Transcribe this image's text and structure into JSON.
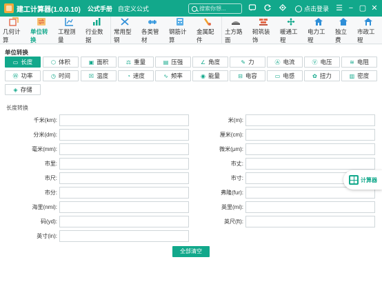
{
  "app": {
    "title": "建工计算器(1.0.0.10)"
  },
  "top_tabs": [
    {
      "label": "公式手册",
      "active": true
    },
    {
      "label": "自定义公式",
      "active": false
    }
  ],
  "search": {
    "placeholder": "搜索你想..."
  },
  "login": {
    "label": "点击登录"
  },
  "toolbar": [
    {
      "label": "几何计算",
      "icon": "geometry-icon",
      "color": "#e36a4a"
    },
    {
      "label": "单位转换",
      "icon": "unit-convert-icon",
      "color": "#f0a030",
      "active": true
    },
    {
      "label": "工程测量",
      "icon": "measure-icon",
      "color": "#2f8fd8"
    },
    {
      "label": "行业数据",
      "icon": "chart-icon",
      "color": "#12a88b"
    },
    {
      "label": "常用型钢",
      "icon": "steel-icon",
      "color": "#2f8fd8"
    },
    {
      "label": "各类管材",
      "icon": "pipe-icon",
      "color": "#2f8fd8"
    },
    {
      "label": "钢筋计算",
      "icon": "rebar-icon",
      "color": "#2f8fd8"
    },
    {
      "label": "金属配件",
      "icon": "metal-icon",
      "color": "#f0a030"
    },
    {
      "label": "土方路面",
      "icon": "earthwork-icon",
      "color": "#7a7a7a"
    },
    {
      "label": "砌筑装饰",
      "icon": "brick-icon",
      "color": "#e36a4a"
    },
    {
      "label": "暖通工程",
      "icon": "hvac-icon",
      "color": "#12a88b"
    },
    {
      "label": "电力工程",
      "icon": "power-icon",
      "color": "#2f8fd8"
    },
    {
      "label": "独立费",
      "icon": "house-icon",
      "color": "#2f8fd8"
    },
    {
      "label": "市政工程",
      "icon": "municipal-icon",
      "color": "#2f8fd8"
    }
  ],
  "section_title": "单位转换",
  "units": [
    {
      "label": "长度",
      "icon": "length-icon",
      "glyph": "▭",
      "active": true
    },
    {
      "label": "体积",
      "icon": "volume-icon",
      "glyph": "⬡"
    },
    {
      "label": "面积",
      "icon": "area-icon",
      "glyph": "▣"
    },
    {
      "label": "重量",
      "icon": "weight-icon",
      "glyph": "⚖"
    },
    {
      "label": "压强",
      "icon": "pressure-icon",
      "glyph": "▤"
    },
    {
      "label": "角度",
      "icon": "angle-icon",
      "glyph": "∠"
    },
    {
      "label": "力",
      "icon": "force-icon",
      "glyph": "✎"
    },
    {
      "label": "电流",
      "icon": "current-icon",
      "glyph": "Ⓐ"
    },
    {
      "label": "电压",
      "icon": "voltage-icon",
      "glyph": "Ⓥ"
    },
    {
      "label": "电阻",
      "icon": "resistance-icon",
      "glyph": "≋"
    },
    {
      "label": "功率",
      "icon": "power-unit-icon",
      "glyph": "Ⓦ"
    },
    {
      "label": "时间",
      "icon": "clock-icon",
      "glyph": "◷"
    },
    {
      "label": "温度",
      "icon": "temperature-icon",
      "glyph": "☒"
    },
    {
      "label": "速度",
      "icon": "speed-icon",
      "glyph": "◔"
    },
    {
      "label": "频率",
      "icon": "frequency-icon",
      "glyph": "∿"
    },
    {
      "label": "能量",
      "icon": "energy-icon",
      "glyph": "◉"
    },
    {
      "label": "电容",
      "icon": "capacitance-icon",
      "glyph": "⊟"
    },
    {
      "label": "电感",
      "icon": "inductance-icon",
      "glyph": "▭"
    },
    {
      "label": "扭力",
      "icon": "torque-icon",
      "glyph": "✿"
    },
    {
      "label": "密度",
      "icon": "density-icon",
      "glyph": "▥"
    },
    {
      "label": "存储",
      "icon": "storage-icon",
      "glyph": "◈"
    }
  ],
  "sub_title": "长度转换",
  "fields_left": [
    {
      "label": "千米(km):",
      "value": ""
    },
    {
      "label": "分米(dm):",
      "value": ""
    },
    {
      "label": "毫米(mm):",
      "value": ""
    },
    {
      "label": "市里:",
      "value": ""
    },
    {
      "label": "市尺:",
      "value": ""
    },
    {
      "label": "市分:",
      "value": ""
    },
    {
      "label": "海里(nmi):",
      "value": ""
    },
    {
      "label": "码(yd):",
      "value": ""
    },
    {
      "label": "英寸(in):",
      "value": ""
    }
  ],
  "fields_right": [
    {
      "label": "米(m):",
      "value": ""
    },
    {
      "label": "厘米(cm):",
      "value": ""
    },
    {
      "label": "微米(μm):",
      "value": ""
    },
    {
      "label": "市丈:",
      "value": ""
    },
    {
      "label": "市寸:",
      "value": ""
    },
    {
      "label": "弗隆(fur):",
      "value": ""
    },
    {
      "label": "英里(mi):",
      "value": ""
    },
    {
      "label": "英尺(ft):",
      "value": ""
    }
  ],
  "clear_button": "全部清空",
  "float_calc": {
    "label": "计算器"
  },
  "colors": {
    "accent": "#12a88b"
  }
}
